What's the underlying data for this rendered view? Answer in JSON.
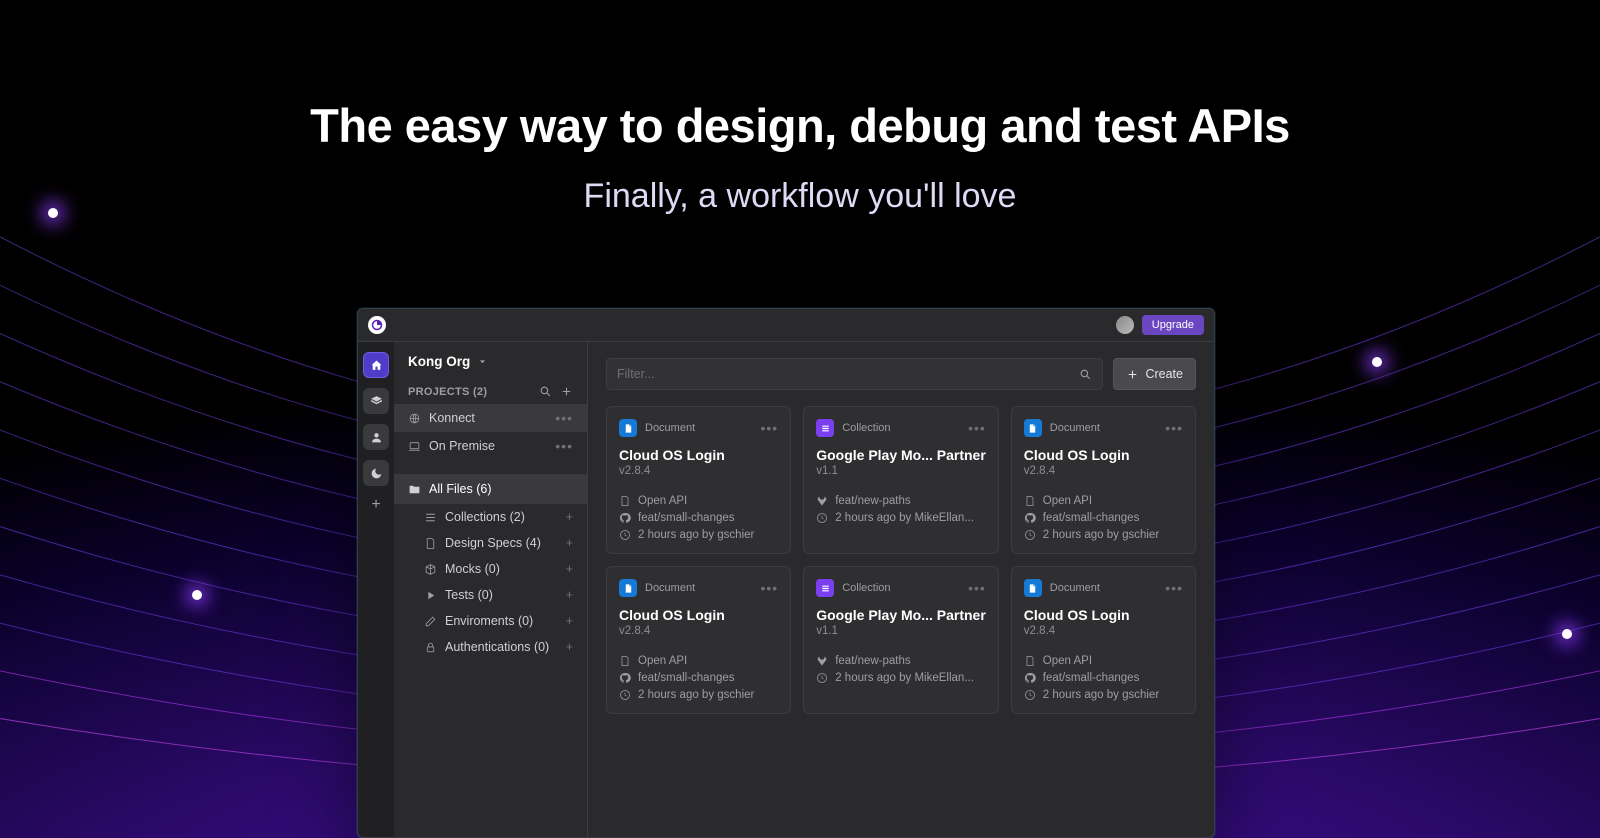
{
  "hero": {
    "title": "The easy way to design, debug and test APIs",
    "subtitle": "Finally, a workflow you'll love"
  },
  "titlebar": {
    "upgrade": "Upgrade"
  },
  "sidebar": {
    "org": "Kong Org",
    "projects_header": "PROJECTS (2)",
    "projects": [
      {
        "label": "Konnect",
        "active": true
      },
      {
        "label": "On Premise",
        "active": false
      }
    ],
    "allfiles": "All Files (6)",
    "categories": [
      {
        "label": "Collections (2)"
      },
      {
        "label": "Design Specs (4)"
      },
      {
        "label": "Mocks (0)"
      },
      {
        "label": "Tests (0)"
      },
      {
        "label": "Enviroments (0)"
      },
      {
        "label": "Authentications (0)"
      }
    ]
  },
  "toolbar": {
    "filter_placeholder": "Filter...",
    "create": "Create"
  },
  "cards": [
    {
      "kind": "doc",
      "kind_label": "Document",
      "title": "Cloud OS Login",
      "version": "v2.8.4",
      "spec": "Open API",
      "branch": "feat/small-changes",
      "time": "2 hours ago by gschier"
    },
    {
      "kind": "col",
      "kind_label": "Collection",
      "title": "Google Play Mo... Partner",
      "version": "v1.1",
      "spec": "",
      "branch": "feat/new-paths",
      "time": "2 hours ago by MikeEllan..."
    },
    {
      "kind": "doc",
      "kind_label": "Document",
      "title": "Cloud OS Login",
      "version": "v2.8.4",
      "spec": "Open API",
      "branch": "feat/small-changes",
      "time": "2 hours ago by gschier"
    },
    {
      "kind": "doc",
      "kind_label": "Document",
      "title": "Cloud OS Login",
      "version": "v2.8.4",
      "spec": "Open API",
      "branch": "feat/small-changes",
      "time": "2 hours ago by gschier"
    },
    {
      "kind": "col",
      "kind_label": "Collection",
      "title": "Google Play Mo... Partner",
      "version": "v1.1",
      "spec": "",
      "branch": "feat/new-paths",
      "time": "2 hours ago by MikeEllan..."
    },
    {
      "kind": "doc",
      "kind_label": "Document",
      "title": "Cloud OS Login",
      "version": "v2.8.4",
      "spec": "Open API",
      "branch": "feat/small-changes",
      "time": "2 hours ago by gschier"
    }
  ]
}
